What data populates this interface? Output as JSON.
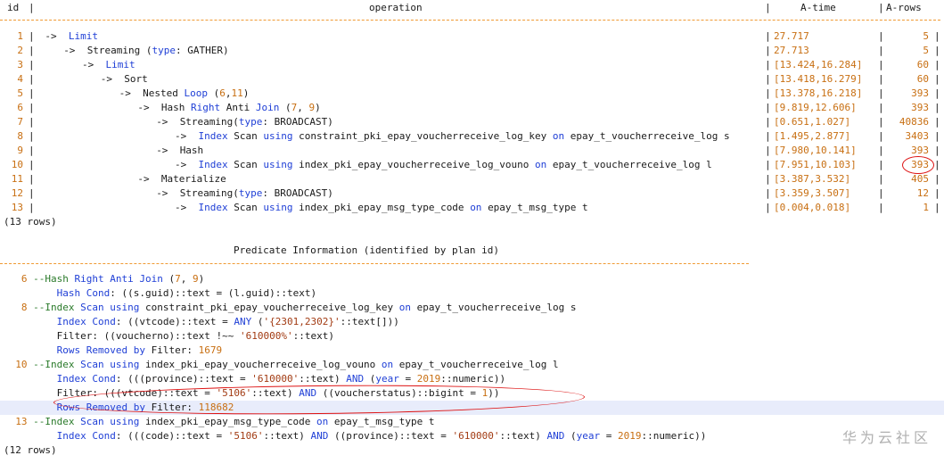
{
  "plan": {
    "headers": {
      "id": "id",
      "operation": "operation",
      "atime": "A-time",
      "arows": "A-rows"
    },
    "rows": [
      {
        "id": "1",
        "indent": 2,
        "op": "->  Limit",
        "atime": "27.717",
        "arows": "5"
      },
      {
        "id": "2",
        "indent": 6,
        "op": "->  Streaming (type: GATHER)",
        "atime": "27.713",
        "arows": "5"
      },
      {
        "id": "3",
        "indent": 10,
        "op": "->  Limit",
        "atime": "[13.424,16.284]",
        "arows": "60"
      },
      {
        "id": "4",
        "indent": 14,
        "op": "->  Sort",
        "atime": "[13.418,16.279]",
        "arows": "60"
      },
      {
        "id": "5",
        "indent": 18,
        "op": "->  Nested Loop (6,11)",
        "atime": "[13.378,16.218]",
        "arows": "393"
      },
      {
        "id": "6",
        "indent": 22,
        "op": "->  Hash Right Anti Join (7, 9)",
        "atime": "[9.819,12.606]",
        "arows": "393"
      },
      {
        "id": "7",
        "indent": 26,
        "op": "->  Streaming(type: BROADCAST)",
        "atime": "[0.651,1.027]",
        "arows": "40836"
      },
      {
        "id": "8",
        "indent": 30,
        "op": "->  Index Scan using constraint_pki_epay_voucherreceive_log_key on epay_t_voucherreceive_log s",
        "atime": "[1.495,2.877]",
        "arows": "3403"
      },
      {
        "id": "9",
        "indent": 26,
        "op": "->  Hash",
        "atime": "[7.980,10.141]",
        "arows": "393"
      },
      {
        "id": "10",
        "indent": 30,
        "op": "->  Index Scan using index_pki_epay_voucherreceive_log_vouno on epay_t_voucherreceive_log l",
        "atime": "[7.951,10.103]",
        "arows": "393"
      },
      {
        "id": "11",
        "indent": 22,
        "op": "->  Materialize",
        "atime": "[3.387,3.532]",
        "arows": "405"
      },
      {
        "id": "12",
        "indent": 26,
        "op": "->  Streaming(type: BROADCAST)",
        "atime": "[3.359,3.507]",
        "arows": "12"
      },
      {
        "id": "13",
        "indent": 30,
        "op": "->  Index Scan using index_pki_epay_msg_type_code on epay_t_msg_type t",
        "atime": "[0.004,0.018]",
        "arows": "1"
      }
    ],
    "footer": "(13 rows)"
  },
  "predicate": {
    "title": "Predicate Information (identified by plan id)",
    "lines": [
      "   6 --Hash Right Anti Join (7, 9)",
      "         Hash Cond: ((s.guid)::text = (l.guid)::text)",
      "   8 --Index Scan using constraint_pki_epay_voucherreceive_log_key on epay_t_voucherreceive_log s",
      "         Index Cond: ((vtcode)::text = ANY ('{2301,2302}'::text[]))",
      "         Filter: ((voucherno)::text !~~ '610000%'::text)",
      "         Rows Removed by Filter: 1679",
      "  10 --Index Scan using index_pki_epay_voucherreceive_log_vouno on epay_t_voucherreceive_log l",
      "         Index Cond: (((province)::text = '610000'::text) AND (year = 2019::numeric))",
      "         Filter: (((vtcode)::text = '5106'::text) AND ((voucherstatus)::bigint = 1))",
      "         Rows Removed by Filter: 118682",
      "  13 --Index Scan using index_pki_epay_msg_type_code on epay_t_msg_type t",
      "         Index Cond: (((code)::text = '5106'::text) AND ((province)::text = '610000'::text) AND (year = 2019::numeric))"
    ],
    "footer": "(12 rows)"
  },
  "watermark": "华为云社区"
}
